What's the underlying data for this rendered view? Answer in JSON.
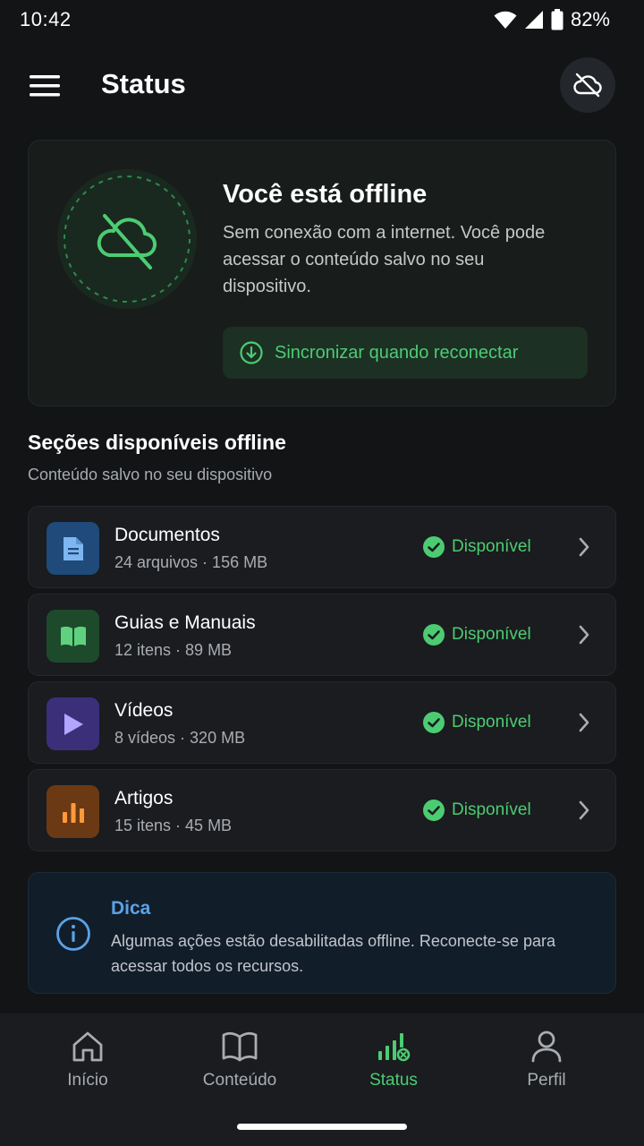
{
  "status_bar": {
    "time": "10:42",
    "battery": "82%"
  },
  "header": {
    "title": "Status"
  },
  "offline_card": {
    "title": "Você está offline",
    "description": "Sem conexão com a internet. Você pode acessar o conteúdo salvo no seu dispositivo.",
    "sync_button": "Sincronizar quando reconectar"
  },
  "sections": {
    "title": "Seções disponíveis offline",
    "subtitle": "Conteúdo salvo no seu dispositivo",
    "items": [
      {
        "name": "Documentos",
        "meta": "24 arquivos · 156 MB",
        "status": "Disponível",
        "icon": "document-icon",
        "color": "#1f4a7a",
        "icon_color": "#7db6f0"
      },
      {
        "name": "Guias e Manuais",
        "meta": "12 itens · 89 MB",
        "status": "Disponível",
        "icon": "book-icon",
        "color": "#1e4a2c",
        "icon_color": "#5fd27f"
      },
      {
        "name": "Vídeos",
        "meta": "8 vídeos · 320 MB",
        "status": "Disponível",
        "icon": "play-icon",
        "color": "#3b2f7a",
        "icon_color": "#b3a6ff"
      },
      {
        "name": "Artigos",
        "meta": "15 itens · 45 MB",
        "status": "Disponível",
        "icon": "chart-icon",
        "color": "#6b3a14",
        "icon_color": "#ff9a3c"
      }
    ]
  },
  "tip": {
    "title": "Dica",
    "text": "Algumas ações estão desabilitadas offline. Reconecte-se para acessar todos os recursos."
  },
  "bottom_nav": {
    "items": [
      {
        "label": "Início",
        "icon": "home-icon"
      },
      {
        "label": "Conteúdo",
        "icon": "book-open-icon"
      },
      {
        "label": "Status",
        "icon": "status-icon",
        "active": true
      },
      {
        "label": "Perfil",
        "icon": "user-icon"
      }
    ]
  },
  "colors": {
    "accent": "#4ccc72",
    "info": "#5aa3e6",
    "background": "#121416"
  }
}
